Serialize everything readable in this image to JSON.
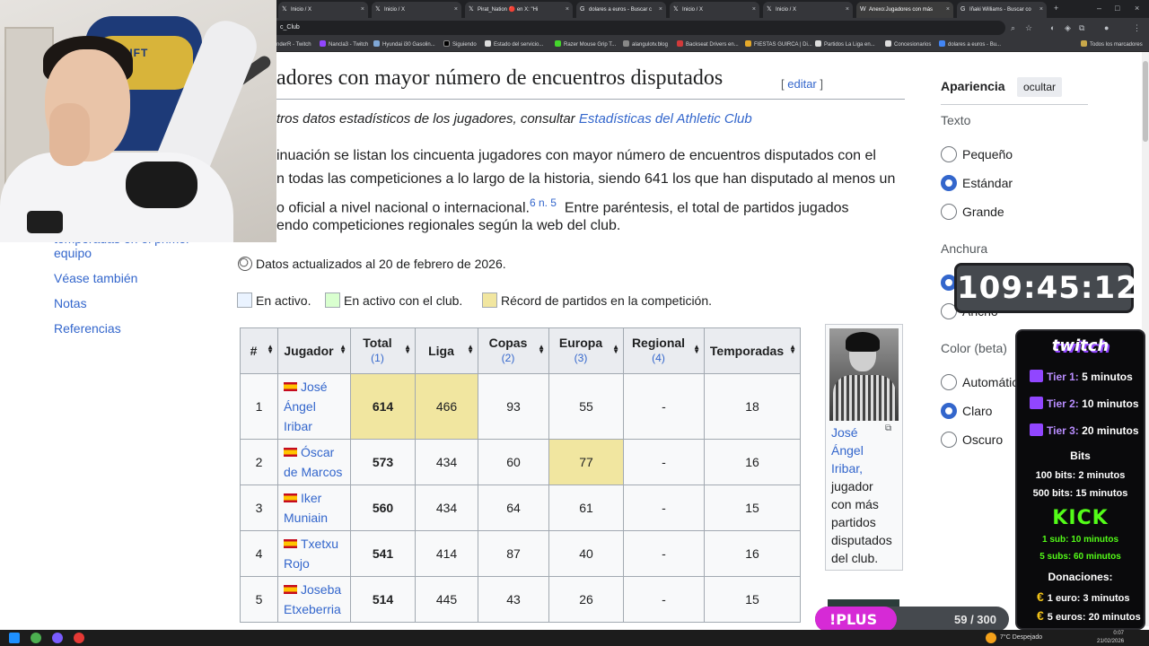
{
  "browser": {
    "tabs": [
      {
        "title": "Inicio / X",
        "icon": "x-logo-icon"
      },
      {
        "title": "Inicio / X",
        "icon": "x-logo-icon"
      },
      {
        "title": "Pirat_Nation 🔴 en X: \"Hi",
        "icon": "x-logo-icon"
      },
      {
        "title": "dolares a euros - Buscar c",
        "icon": "google-icon"
      },
      {
        "title": "Inicio / X",
        "icon": "x-logo-icon"
      },
      {
        "title": "Inicio / X",
        "icon": "x-logo-icon"
      },
      {
        "title": "Anexo:Jugadores con más",
        "icon": "wikipedia-icon",
        "active": true
      },
      {
        "title": "Iñaki Williams - Buscar co",
        "icon": "google-icon"
      }
    ],
    "url_fragment": "c_Club",
    "bookmarks": [
      "nderR - Twitch",
      "Nancla3 - Twitch",
      "Hyundai i30 Gasolin...",
      "Siguiendo",
      "Estado del servicio...",
      "Razer Mouse Grip T...",
      "alangulotv.blog",
      "Backseat Drivers en...",
      "FIESTAS GUIRCA | Di...",
      "Partidos La Liga en...",
      "Concesionarios",
      "dolares a euros - Bu..."
    ],
    "all_bookmarks": "Todos los marcadores"
  },
  "article": {
    "heading": "adores con mayor número de encuentros disputados",
    "edit_label": "editar",
    "hatnote_prefix": "tros datos estadísticos de los jugadores, consultar",
    "hatnote_link": "Estadísticas del Athletic Club",
    "para_lines": [
      "inuación se listan los cincuenta jugadores con mayor número de encuentros disputados con el",
      "n todas las competiciones a lo largo de la historia, siendo 641 los que han disputado al menos un",
      "o oficial a nivel nacional o internacional.",
      "endo competiciones regionales según la web del club."
    ],
    "para_ref": "6 n. 5",
    "para_line3_tail": "Entre paréntesis, el total de partidos jugados",
    "updated": "Datos actualizados al 20 de febrero de 2026.",
    "legend": [
      "En activo.",
      "En activo con el club.",
      "Récord de partidos en la competición."
    ],
    "legend_colors": [
      "#eaf3ff",
      "#d9ffcf",
      "#f1e6a0"
    ]
  },
  "toc": {
    "items": [
      "temporadas en el primer equipo",
      "Véase también",
      "Notas",
      "Referencias"
    ]
  },
  "table": {
    "headers": [
      {
        "label": "#",
        "sub": ""
      },
      {
        "label": "Jugador",
        "sub": ""
      },
      {
        "label": "Total",
        "sub": "(1)"
      },
      {
        "label": "Liga",
        "sub": ""
      },
      {
        "label": "Copas",
        "sub": "(2)"
      },
      {
        "label": "Europa",
        "sub": "(3)"
      },
      {
        "label": "Regional",
        "sub": "(4)"
      },
      {
        "label": "Temporadas",
        "sub": ""
      }
    ],
    "rows": [
      {
        "rank": "1",
        "name1": "José",
        "name2": "Ángel",
        "name3": "Iribar",
        "total": "614",
        "liga": "466",
        "copas": "93",
        "europa": "55",
        "regional": "-",
        "temporadas": "18"
      },
      {
        "rank": "2",
        "name1": "Óscar",
        "name2": "de Marcos",
        "total": "573",
        "liga": "434",
        "copas": "60",
        "europa": "77",
        "regional": "-",
        "temporadas": "16"
      },
      {
        "rank": "3",
        "name1": "Iker",
        "name2": "Muniain",
        "total": "560",
        "liga": "434",
        "copas": "64",
        "europa": "61",
        "regional": "-",
        "temporadas": "15"
      },
      {
        "rank": "4",
        "name1": "Txetxu",
        "name2": "Rojo",
        "total": "541",
        "liga": "414",
        "copas": "87",
        "europa": "40",
        "regional": "-",
        "temporadas": "16"
      },
      {
        "rank": "5",
        "name1": "Joseba",
        "name2": "Etxeberria",
        "total": "514",
        "liga": "445",
        "copas": "43",
        "europa": "26",
        "regional": "-",
        "temporadas": "15"
      }
    ]
  },
  "figure": {
    "caption_link": [
      "José",
      "Ángel",
      "Iribar,"
    ],
    "caption_rest": [
      "jugador",
      "con más",
      "partidos",
      "disputados",
      "del club."
    ]
  },
  "sidebar": {
    "appearance": "Apariencia",
    "hide": "ocultar",
    "text_heading": "Texto",
    "text_options": [
      "Pequeño",
      "Estándar",
      "Grande"
    ],
    "width_heading": "Anchura",
    "width_option_partial": "Ancho",
    "color_heading": "Color (beta)",
    "color_options": [
      "Automátic",
      "Claro",
      "Oscuro"
    ]
  },
  "overlay": {
    "timer": "109:45:12",
    "twitch": "twitch",
    "tiers": [
      {
        "label": "Tier 1:",
        "value": "5 minutos"
      },
      {
        "label": "Tier 2:",
        "value": "10 minutos"
      },
      {
        "label": "Tier 3:",
        "value": "20 minutos"
      }
    ],
    "bits_title": "Bits",
    "bits": [
      "100 bits: 2 minutos",
      "500 bits: 15 minutos"
    ],
    "kick": "KICK",
    "kick_lines": [
      "1 sub: 10 minutos",
      "5 subs: 60 minutos"
    ],
    "donations_title": "Donaciones:",
    "donations": [
      "1 euro: 3 minutos",
      "5 euros: 20 minutos"
    ],
    "plus_label": "!PLUS",
    "plus_count": "59 / 300",
    "plus_progress": 0.197
  },
  "taskbar": {
    "weather": "7°C  Despejado",
    "time": "0:07",
    "date": "21/02/2026"
  }
}
